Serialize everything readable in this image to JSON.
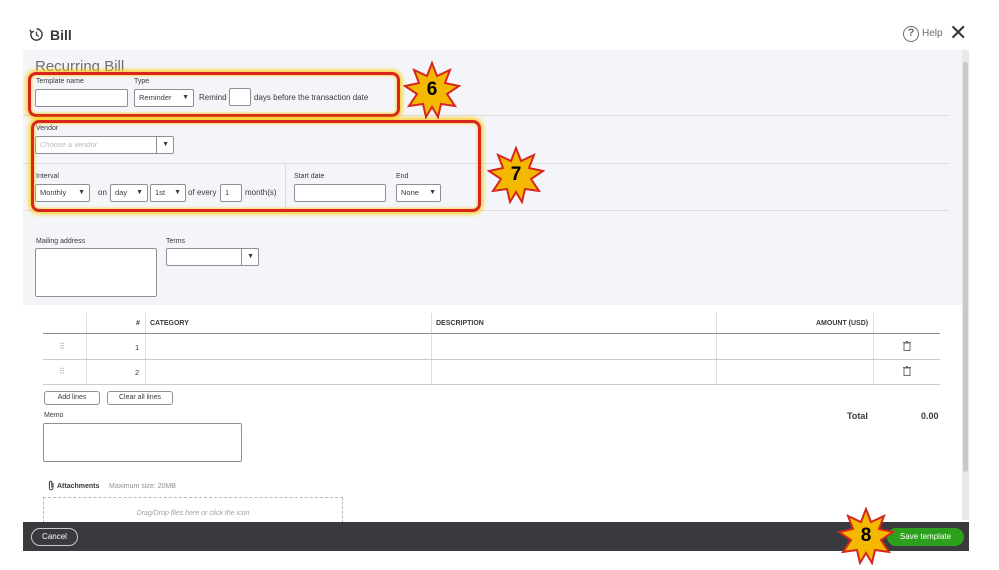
{
  "window": {
    "title": "Bill",
    "help_label": "Help"
  },
  "form": {
    "heading": "Recurring Bill",
    "template_name": {
      "label": "Template name",
      "value": ""
    },
    "type": {
      "label": "Type",
      "value": "Reminder"
    },
    "remind": {
      "label": "Remind",
      "value": "",
      "suffix": "days before the transaction date"
    },
    "vendor": {
      "label": "Vendor",
      "placeholder": "Choose a vendor"
    },
    "interval": {
      "label": "Interval",
      "frequency": "Monthly",
      "on_label": "on",
      "day_type": "day",
      "day_value": "1st",
      "of_every_label": "of every",
      "every_value": "1",
      "unit_label": "month(s)"
    },
    "start_date": {
      "label": "Start date",
      "value": ""
    },
    "end": {
      "label": "End",
      "value": "None"
    },
    "mailing_address": {
      "label": "Mailing address",
      "value": ""
    },
    "terms": {
      "label": "Terms",
      "value": ""
    }
  },
  "table": {
    "columns": [
      "#",
      "CATEGORY",
      "DESCRIPTION",
      "AMOUNT (USD)"
    ],
    "rows": [
      {
        "num": "1",
        "category": "",
        "description": "",
        "amount": ""
      },
      {
        "num": "2",
        "category": "",
        "description": "",
        "amount": ""
      }
    ],
    "add_lines_label": "Add lines",
    "clear_lines_label": "Clear all lines"
  },
  "memo": {
    "label": "Memo",
    "value": ""
  },
  "totals": {
    "label": "Total",
    "value": "0.00"
  },
  "attachments": {
    "label": "Attachments",
    "max_size": "Maximum size: 20MB",
    "dropzone_text": "Drag/Drop files here or click the icon"
  },
  "footer": {
    "cancel_label": "Cancel",
    "save_label": "Save template"
  },
  "callouts": {
    "six": "6",
    "seven": "7",
    "eight": "8"
  },
  "colors": {
    "brand_green": "#2ca01c",
    "footer_bg": "#393a3d",
    "callout_outline": "#d6261f",
    "callout_star": "#f5b800"
  },
  "icons": [
    "bill-recurring-icon",
    "help-icon",
    "close-icon",
    "chevron-down-icon",
    "drag-handle-icon",
    "trash-icon",
    "paperclip-icon"
  ]
}
